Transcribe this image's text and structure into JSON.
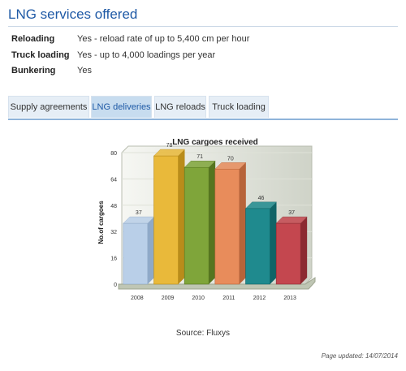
{
  "page": {
    "title": "LNG services offered",
    "source": "Source: Fluxys",
    "updated": "Page updated: 14/07/2014"
  },
  "services": [
    {
      "label": "Reloading",
      "value": "Yes - reload rate of up to 5,400 cm per hour"
    },
    {
      "label": "Truck loading",
      "value": "Yes - up to 4,000 loadings per year"
    },
    {
      "label": "Bunkering",
      "value": "Yes"
    }
  ],
  "tabs": [
    {
      "label": "Supply agreements",
      "active": false
    },
    {
      "label": "LNG deliveries",
      "active": true
    },
    {
      "label": "LNG reloads",
      "active": false
    },
    {
      "label": "Truck loading",
      "active": false
    }
  ],
  "colors": {
    "title": "#1f5aa6",
    "bars": [
      "#b9cfe8",
      "#e9b93a",
      "#7fa53a",
      "#e88c5b",
      "#1f8a8e",
      "#c4474f"
    ],
    "bars_dark": [
      "#8fa9c8",
      "#b98c1a",
      "#55751f",
      "#b7643a",
      "#106467",
      "#8c2a31"
    ]
  },
  "chart_data": {
    "type": "bar",
    "title": "LNG cargoes received",
    "ylabel": "No.of cargoes",
    "xlabel": "",
    "categories": [
      "2008",
      "2009",
      "2010",
      "2011",
      "2012",
      "2013"
    ],
    "values": [
      37,
      78,
      71,
      70,
      46,
      37
    ],
    "ylim": [
      0,
      80
    ],
    "yticks": [
      0,
      16,
      32,
      48,
      64,
      80
    ],
    "grid": true,
    "style": "3d"
  }
}
